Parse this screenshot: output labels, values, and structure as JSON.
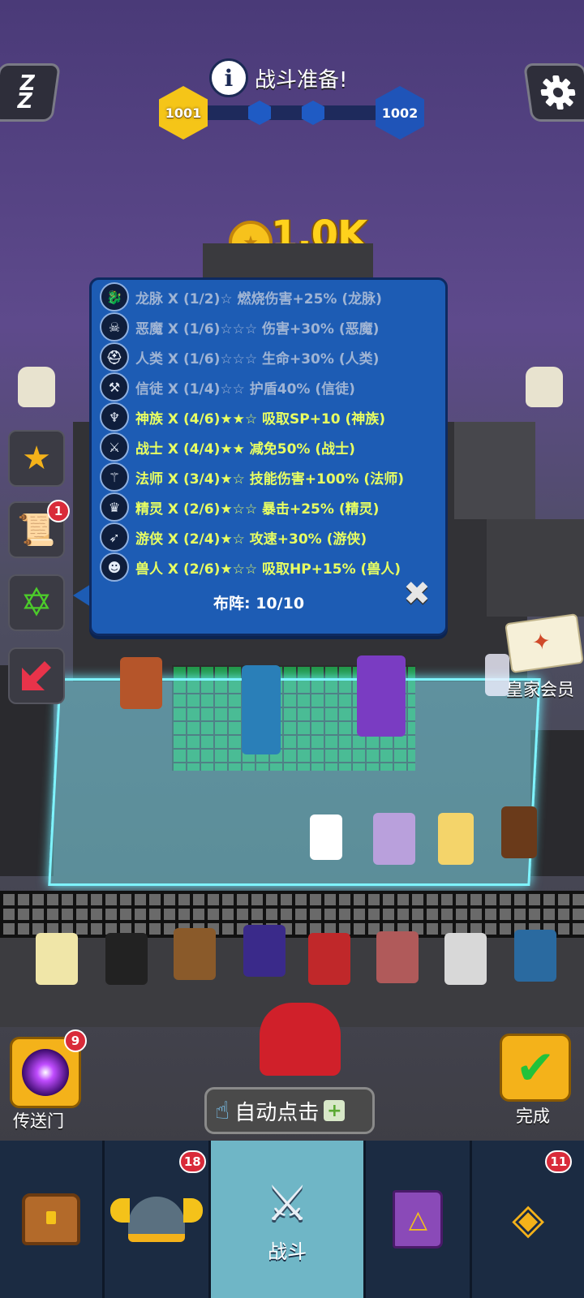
{
  "header": {
    "title": "战斗准备!",
    "level_current": "1001",
    "level_next": "1002"
  },
  "coins": {
    "value": "1.0K"
  },
  "synergy_panel": {
    "rows": [
      {
        "icon": "dragon-icon",
        "text": "龙脉 X (1/2)☆ 燃烧伤害+25% (龙脉)",
        "active": false
      },
      {
        "icon": "demon-skull-icon",
        "text": "恶魔 X (1/6)☆☆☆ 伤害+30% (恶魔)",
        "active": false
      },
      {
        "icon": "helmet-icon",
        "text": "人类 X (1/6)☆☆☆ 生命+30% (人类)",
        "active": false
      },
      {
        "icon": "hammer-icon",
        "text": "信徒 X (1/4)☆☆ 护盾40% (信徒)",
        "active": false
      },
      {
        "icon": "wings-icon",
        "text": "神族 X (4/6)★★☆ 吸取SP+10 (神族)",
        "active": true
      },
      {
        "icon": "sword-icon",
        "text": "战士 X (4/4)★★ 减免50% (战士)",
        "active": true
      },
      {
        "icon": "staff-icon",
        "text": "法师 X (3/4)★☆ 技能伤害+100% (法师)",
        "active": true
      },
      {
        "icon": "elf-icon",
        "text": "精灵 X (2/6)★☆☆ 暴击+25% (精灵)",
        "active": true
      },
      {
        "icon": "bow-icon",
        "text": "游侠 X (2/4)★☆ 攻速+30% (游侠)",
        "active": true
      },
      {
        "icon": "orc-icon",
        "text": "兽人 X (2/6)★☆☆ 吸取HP+15% (兽人)",
        "active": true
      }
    ],
    "formation_label": "布阵: 10/10"
  },
  "side_menu": {
    "quest_badge": "1"
  },
  "vip": {
    "label": "皇家会员"
  },
  "portal": {
    "label": "传送门",
    "badge": "9"
  },
  "auto_click": {
    "label": "自动点击",
    "plus": "+"
  },
  "done": {
    "label": "完成"
  },
  "nav": {
    "tabs": [
      {
        "name": "chest",
        "icon": "treasure-chest-icon"
      },
      {
        "name": "heroes",
        "icon": "viking-helmet-icon",
        "badge": "18"
      },
      {
        "name": "battle",
        "icon": "crossed-swords-icon",
        "label": "战斗"
      },
      {
        "name": "book",
        "icon": "spellbook-icon"
      },
      {
        "name": "amulet",
        "icon": "amulet-icon",
        "badge": "11"
      }
    ]
  }
}
